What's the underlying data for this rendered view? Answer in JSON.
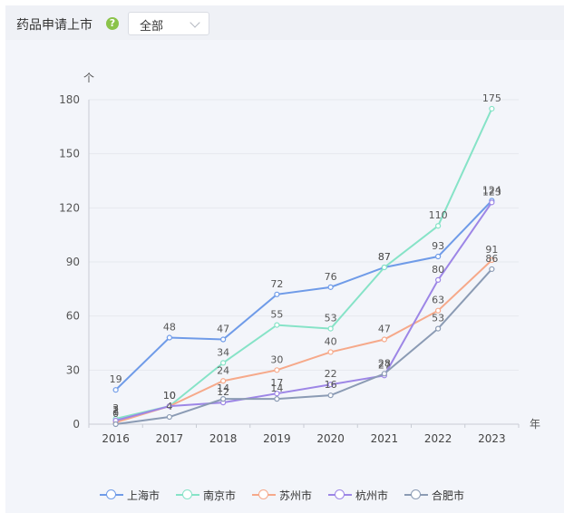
{
  "header": {
    "title": "药品申请上市",
    "help_icon": "?",
    "filter_value": "全部"
  },
  "chart_data": {
    "type": "line",
    "x_unit": "年",
    "y_unit": "个",
    "categories": [
      "2016",
      "2017",
      "2018",
      "2019",
      "2020",
      "2021",
      "2022",
      "2023"
    ],
    "ylim": [
      0,
      180
    ],
    "yticks": [
      0,
      30,
      60,
      90,
      120,
      150,
      180
    ],
    "grid": true,
    "legend_position": "bottom",
    "series": [
      {
        "name": "上海市",
        "color": "#6f9be8",
        "values": [
          19,
          48,
          47,
          72,
          76,
          87,
          93,
          124
        ]
      },
      {
        "name": "南京市",
        "color": "#86e3c7",
        "values": [
          3,
          10,
          34,
          55,
          53,
          87,
          110,
          175
        ]
      },
      {
        "name": "苏州市",
        "color": "#f6a98a",
        "values": [
          1,
          10,
          24,
          30,
          40,
          47,
          63,
          91
        ]
      },
      {
        "name": "杭州市",
        "color": "#9d86e6",
        "values": [
          2,
          10,
          12,
          17,
          22,
          27,
          80,
          123
        ]
      },
      {
        "name": "合肥市",
        "color": "#8b9bb4",
        "values": [
          0,
          4,
          14,
          14,
          16,
          28,
          53,
          86
        ]
      }
    ]
  }
}
